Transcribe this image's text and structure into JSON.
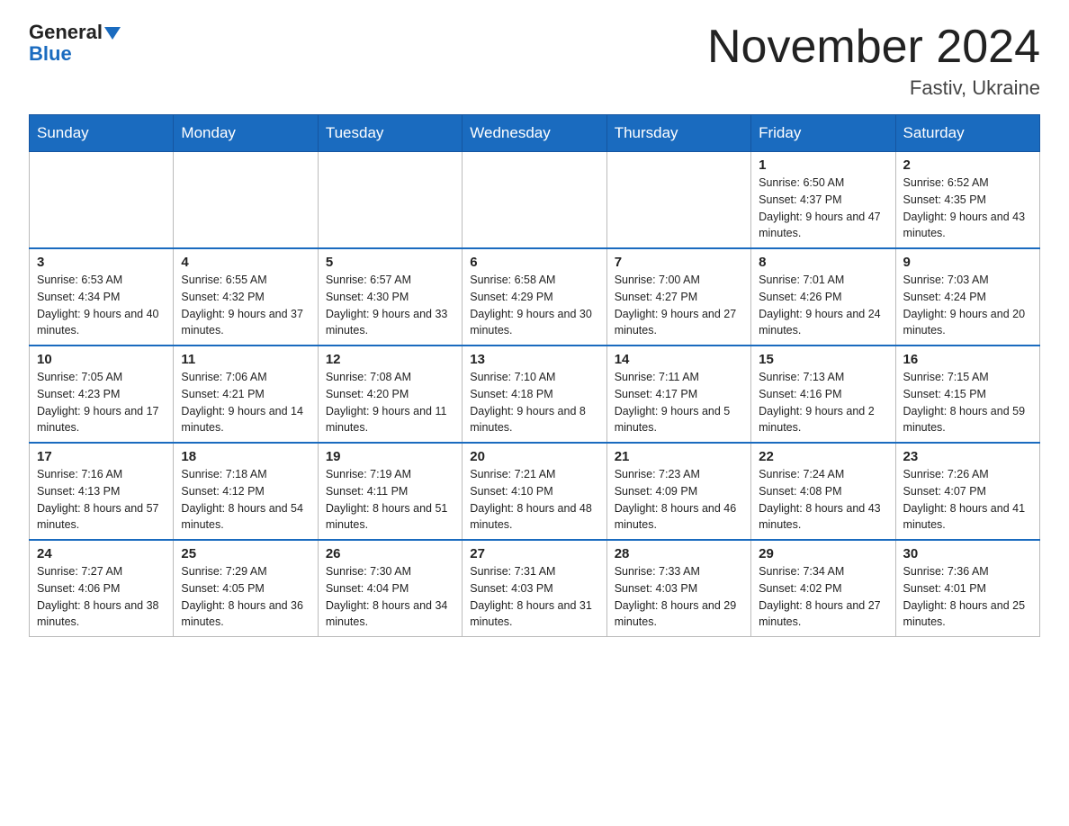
{
  "header": {
    "logo_general": "General",
    "logo_blue": "Blue",
    "month_title": "November 2024",
    "location": "Fastiv, Ukraine"
  },
  "weekdays": [
    "Sunday",
    "Monday",
    "Tuesday",
    "Wednesday",
    "Thursday",
    "Friday",
    "Saturday"
  ],
  "weeks": [
    [
      {
        "day": "",
        "info": ""
      },
      {
        "day": "",
        "info": ""
      },
      {
        "day": "",
        "info": ""
      },
      {
        "day": "",
        "info": ""
      },
      {
        "day": "",
        "info": ""
      },
      {
        "day": "1",
        "info": "Sunrise: 6:50 AM\nSunset: 4:37 PM\nDaylight: 9 hours and 47 minutes."
      },
      {
        "day": "2",
        "info": "Sunrise: 6:52 AM\nSunset: 4:35 PM\nDaylight: 9 hours and 43 minutes."
      }
    ],
    [
      {
        "day": "3",
        "info": "Sunrise: 6:53 AM\nSunset: 4:34 PM\nDaylight: 9 hours and 40 minutes."
      },
      {
        "day": "4",
        "info": "Sunrise: 6:55 AM\nSunset: 4:32 PM\nDaylight: 9 hours and 37 minutes."
      },
      {
        "day": "5",
        "info": "Sunrise: 6:57 AM\nSunset: 4:30 PM\nDaylight: 9 hours and 33 minutes."
      },
      {
        "day": "6",
        "info": "Sunrise: 6:58 AM\nSunset: 4:29 PM\nDaylight: 9 hours and 30 minutes."
      },
      {
        "day": "7",
        "info": "Sunrise: 7:00 AM\nSunset: 4:27 PM\nDaylight: 9 hours and 27 minutes."
      },
      {
        "day": "8",
        "info": "Sunrise: 7:01 AM\nSunset: 4:26 PM\nDaylight: 9 hours and 24 minutes."
      },
      {
        "day": "9",
        "info": "Sunrise: 7:03 AM\nSunset: 4:24 PM\nDaylight: 9 hours and 20 minutes."
      }
    ],
    [
      {
        "day": "10",
        "info": "Sunrise: 7:05 AM\nSunset: 4:23 PM\nDaylight: 9 hours and 17 minutes."
      },
      {
        "day": "11",
        "info": "Sunrise: 7:06 AM\nSunset: 4:21 PM\nDaylight: 9 hours and 14 minutes."
      },
      {
        "day": "12",
        "info": "Sunrise: 7:08 AM\nSunset: 4:20 PM\nDaylight: 9 hours and 11 minutes."
      },
      {
        "day": "13",
        "info": "Sunrise: 7:10 AM\nSunset: 4:18 PM\nDaylight: 9 hours and 8 minutes."
      },
      {
        "day": "14",
        "info": "Sunrise: 7:11 AM\nSunset: 4:17 PM\nDaylight: 9 hours and 5 minutes."
      },
      {
        "day": "15",
        "info": "Sunrise: 7:13 AM\nSunset: 4:16 PM\nDaylight: 9 hours and 2 minutes."
      },
      {
        "day": "16",
        "info": "Sunrise: 7:15 AM\nSunset: 4:15 PM\nDaylight: 8 hours and 59 minutes."
      }
    ],
    [
      {
        "day": "17",
        "info": "Sunrise: 7:16 AM\nSunset: 4:13 PM\nDaylight: 8 hours and 57 minutes."
      },
      {
        "day": "18",
        "info": "Sunrise: 7:18 AM\nSunset: 4:12 PM\nDaylight: 8 hours and 54 minutes."
      },
      {
        "day": "19",
        "info": "Sunrise: 7:19 AM\nSunset: 4:11 PM\nDaylight: 8 hours and 51 minutes."
      },
      {
        "day": "20",
        "info": "Sunrise: 7:21 AM\nSunset: 4:10 PM\nDaylight: 8 hours and 48 minutes."
      },
      {
        "day": "21",
        "info": "Sunrise: 7:23 AM\nSunset: 4:09 PM\nDaylight: 8 hours and 46 minutes."
      },
      {
        "day": "22",
        "info": "Sunrise: 7:24 AM\nSunset: 4:08 PM\nDaylight: 8 hours and 43 minutes."
      },
      {
        "day": "23",
        "info": "Sunrise: 7:26 AM\nSunset: 4:07 PM\nDaylight: 8 hours and 41 minutes."
      }
    ],
    [
      {
        "day": "24",
        "info": "Sunrise: 7:27 AM\nSunset: 4:06 PM\nDaylight: 8 hours and 38 minutes."
      },
      {
        "day": "25",
        "info": "Sunrise: 7:29 AM\nSunset: 4:05 PM\nDaylight: 8 hours and 36 minutes."
      },
      {
        "day": "26",
        "info": "Sunrise: 7:30 AM\nSunset: 4:04 PM\nDaylight: 8 hours and 34 minutes."
      },
      {
        "day": "27",
        "info": "Sunrise: 7:31 AM\nSunset: 4:03 PM\nDaylight: 8 hours and 31 minutes."
      },
      {
        "day": "28",
        "info": "Sunrise: 7:33 AM\nSunset: 4:03 PM\nDaylight: 8 hours and 29 minutes."
      },
      {
        "day": "29",
        "info": "Sunrise: 7:34 AM\nSunset: 4:02 PM\nDaylight: 8 hours and 27 minutes."
      },
      {
        "day": "30",
        "info": "Sunrise: 7:36 AM\nSunset: 4:01 PM\nDaylight: 8 hours and 25 minutes."
      }
    ]
  ]
}
